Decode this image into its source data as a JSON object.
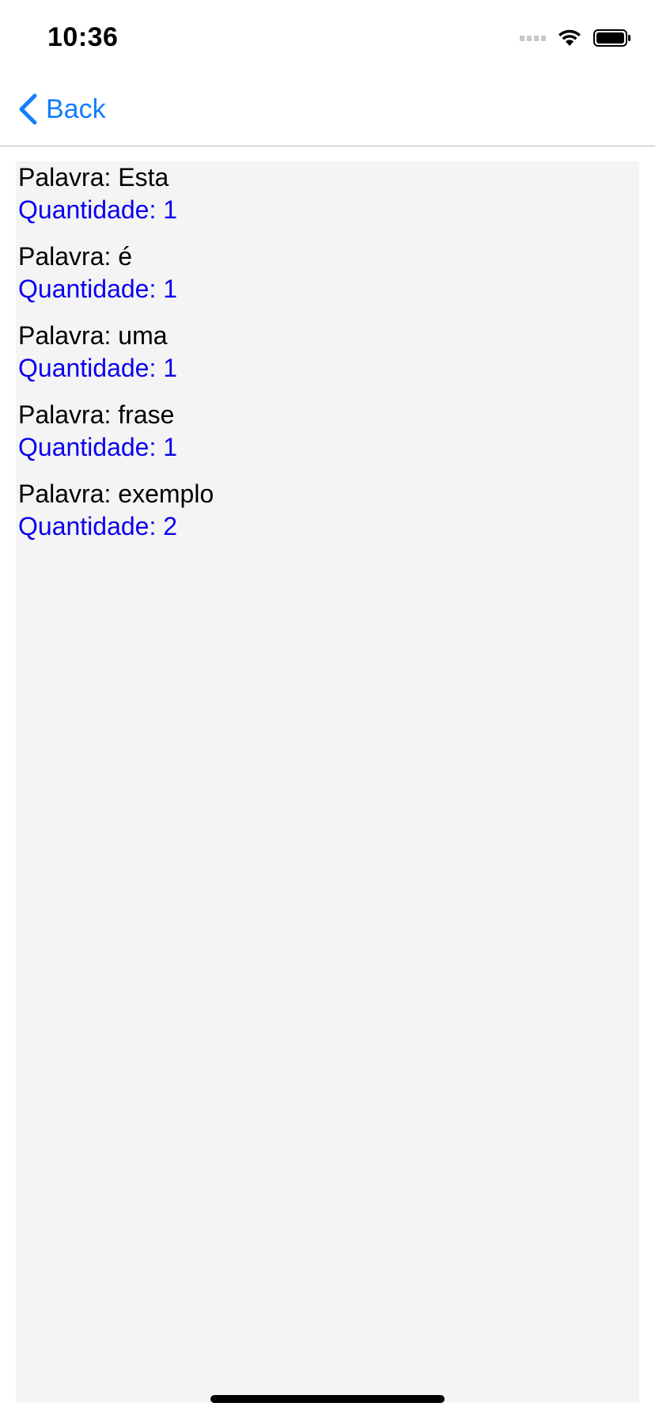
{
  "status_bar": {
    "time": "10:36"
  },
  "nav": {
    "back_label": "Back",
    "back_icon": "chevron-left-icon"
  },
  "colors": {
    "accent": "#147efb",
    "count_text": "#0a00ee",
    "content_background": "#f4f4f4"
  },
  "words": [
    {
      "word_text": "Palavra: Esta",
      "count_text": "Quantidade: 1"
    },
    {
      "word_text": "Palavra: é",
      "count_text": "Quantidade: 1"
    },
    {
      "word_text": "Palavra: uma",
      "count_text": "Quantidade: 1"
    },
    {
      "word_text": "Palavra: frase",
      "count_text": "Quantidade: 1"
    },
    {
      "word_text": "Palavra: exemplo",
      "count_text": "Quantidade: 2"
    }
  ]
}
